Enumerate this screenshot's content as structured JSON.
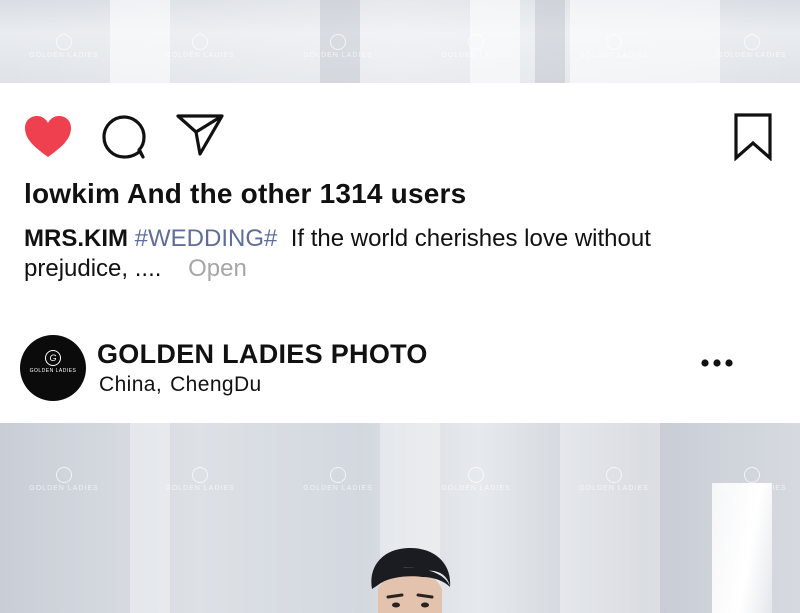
{
  "post": {
    "likes_text": "lowkim And the other 1314 users",
    "caption": {
      "username": "MRS.KIM",
      "hashtag": "#WEDDING#",
      "text": "If the world cherishes love without prejudice, ....",
      "more_label": "Open"
    }
  },
  "next_post": {
    "account_name": "GOLDEN LADIES PHOTO",
    "location_country": "China,",
    "location_city": "ChengDu",
    "avatar_text": "GOLDEN LADIES"
  },
  "watermark_text": "GOLDEN LADIES",
  "icons": {
    "like": "heart-icon",
    "comment": "comment-icon",
    "share": "send-icon",
    "save": "bookmark-icon",
    "more": "more-icon"
  },
  "colors": {
    "like_active": "#ef4050",
    "hashtag": "#5e6d9c",
    "more_link": "#a6a6a6"
  }
}
